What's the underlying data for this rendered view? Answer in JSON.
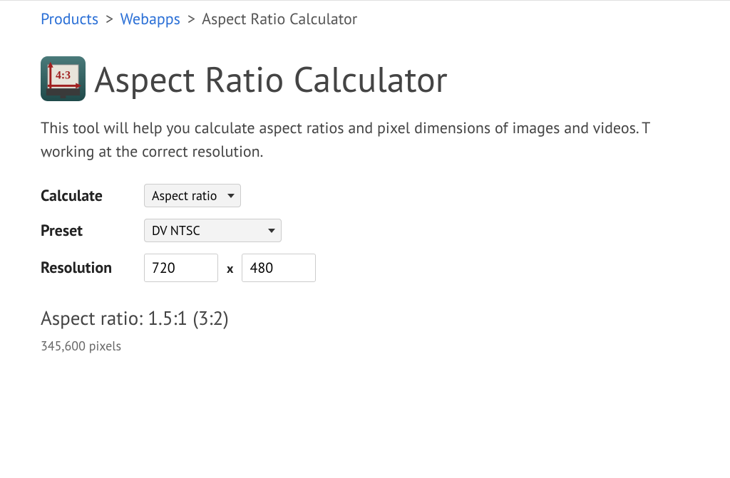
{
  "breadcrumb": {
    "products": "Products",
    "webapps": "Webapps",
    "current": "Aspect Ratio Calculator",
    "sep": ">"
  },
  "icon": {
    "ratio_text": "4:3"
  },
  "title": "Aspect Ratio Calculator",
  "description_line1": "This tool will help you calculate aspect ratios and pixel dimensions of images and videos. T",
  "description_line2": "working at the correct resolution.",
  "form": {
    "calculate_label": "Calculate",
    "calculate_value": "Aspect ratio",
    "preset_label": "Preset",
    "preset_value": "DV NTSC",
    "resolution_label": "Resolution",
    "width_value": "720",
    "height_value": "480",
    "x_sep": "x"
  },
  "result": {
    "ratio": "Aspect ratio: 1.5:1 (3:2)",
    "pixels": "345,600 pixels"
  }
}
